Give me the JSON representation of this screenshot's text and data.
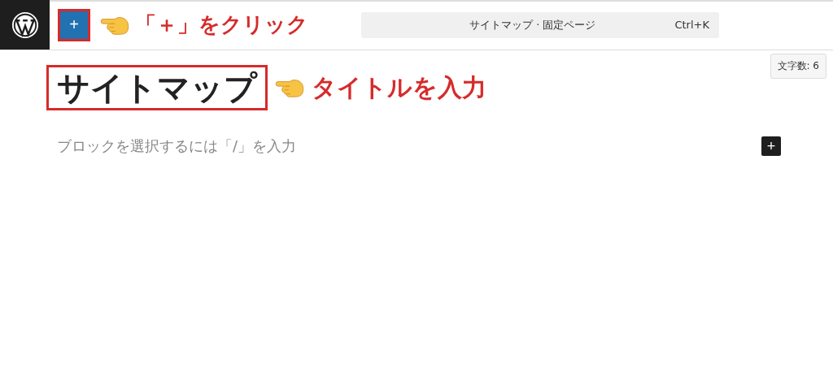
{
  "toolbar": {
    "add_block_label": "+",
    "add_block_highlighted": true,
    "annotation": "「＋」をクリック"
  },
  "command_bar": {
    "title": "サイトマップ · 固定ページ",
    "shortcut": "Ctrl+K"
  },
  "word_count": "文字数: 6",
  "post_title": {
    "text": "サイトマップ",
    "highlighted": true,
    "annotation": "タイトルを入力"
  },
  "block_placeholder": "ブロックを選択するには「/」を入力",
  "inserter_label": "+"
}
